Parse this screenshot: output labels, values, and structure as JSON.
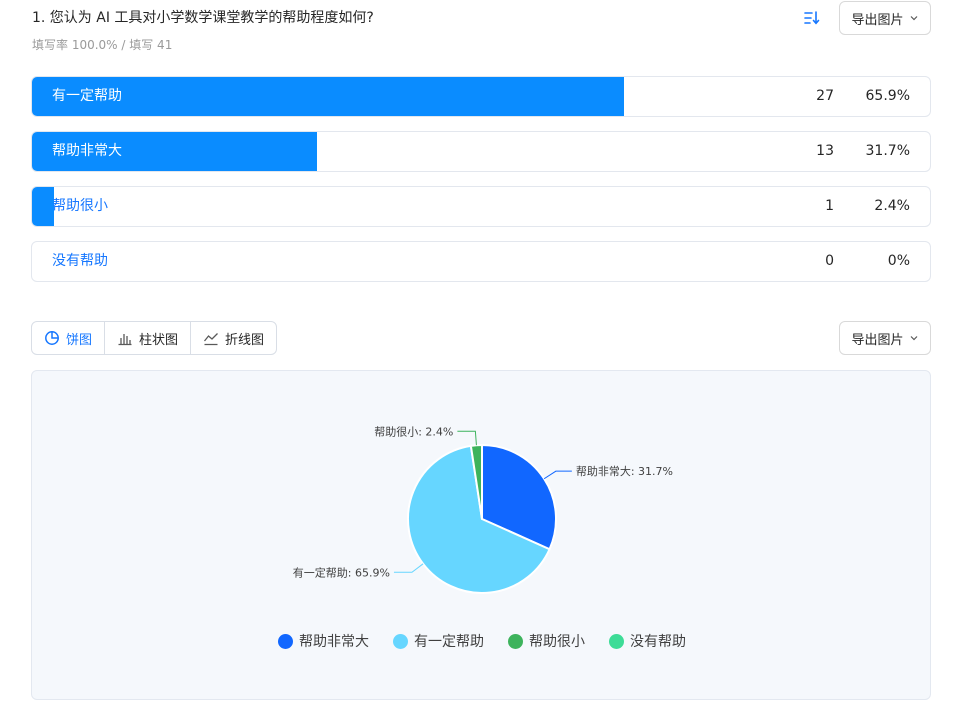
{
  "question": {
    "title": "1. 您认为 AI 工具对小学数学课堂教学的帮助程度如何?",
    "meta": "填写率 100.0% / 填写 41"
  },
  "icons": {
    "sort": "sort-icon",
    "chevron": "chevron-down-icon"
  },
  "export_label": "导出图片",
  "options": [
    {
      "label": "有一定帮助",
      "count": "27",
      "percent": "65.9%",
      "fraction": 0.659
    },
    {
      "label": "帮助非常大",
      "count": "13",
      "percent": "31.7%",
      "fraction": 0.317
    },
    {
      "label": "帮助很小",
      "count": "1",
      "percent": "2.4%",
      "fraction": 0.024
    },
    {
      "label": "没有帮助",
      "count": "0",
      "percent": "0%",
      "fraction": 0
    }
  ],
  "chart_tabs": [
    {
      "label": "饼图",
      "icon": "pie-chart-icon",
      "active": true
    },
    {
      "label": "柱状图",
      "icon": "bar-chart-icon",
      "active": false
    },
    {
      "label": "折线图",
      "icon": "line-chart-icon",
      "active": false
    }
  ],
  "colors": {
    "bar_fill": "#0a8cff",
    "accent": "#1677ff"
  },
  "chart_data": {
    "type": "pie",
    "slices": [
      {
        "name": "帮助非常大",
        "value": 31.7,
        "label": "帮助非常大: 31.7%",
        "color": "#1167ff"
      },
      {
        "name": "有一定帮助",
        "value": 65.9,
        "label": "有一定帮助: 65.9%",
        "color": "#66d6ff"
      },
      {
        "name": "帮助很小",
        "value": 2.4,
        "label": "帮助很小: 2.4%",
        "color": "#3db35c"
      },
      {
        "name": "没有帮助",
        "value": 0,
        "label": "",
        "color": "#3ddc97"
      }
    ],
    "legend": [
      "帮助非常大",
      "有一定帮助",
      "帮助很小",
      "没有帮助"
    ],
    "legend_position": "bottom"
  }
}
